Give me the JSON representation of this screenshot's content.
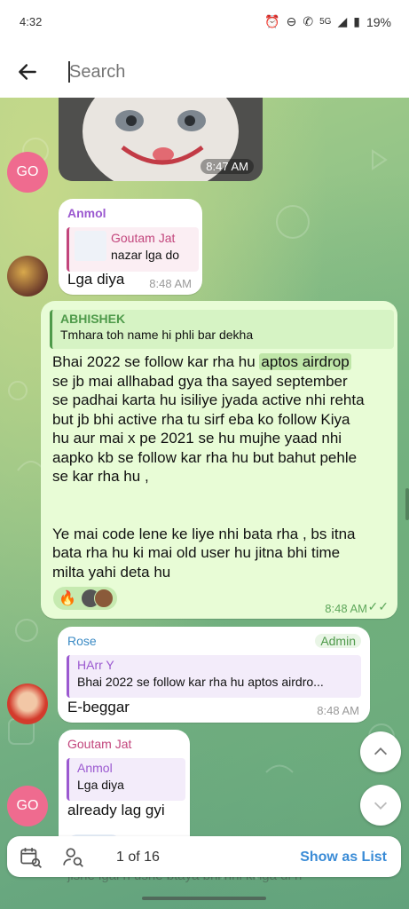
{
  "status_bar": {
    "time": "4:32",
    "network": "5G",
    "battery": "19%"
  },
  "search": {
    "placeholder": "Search"
  },
  "messages": [
    {
      "type": "photo",
      "time": "8:47 AM",
      "avatar_initials": "GO"
    },
    {
      "sender": "Anmol",
      "reply_to": {
        "name": "Goutam Jat",
        "text": "nazar lga do"
      },
      "text": "Lga diya",
      "time": "8:48 AM"
    },
    {
      "reply_to": {
        "name": "ABHISHEK",
        "text": "Tmhara toh name hi phli bar dekha"
      },
      "lines": [
        "Bhai 2022 se follow kar rha hu aptos airdrop",
        "se jb mai allhabad gya tha sayed september",
        "se padhai karta hu isiliye jyada active nhi rehta",
        "but jb bhi active rha tu sirf eba ko follow Kiya",
        "hu aur mai x pe 2021 se hu mujhe yaad nhi",
        "aapko kb se follow kar rha hu but bahut pehle",
        "se kar rha hu ,",
        "",
        "",
        "Ye mai code lene ke liye nhi bata rha , bs itna",
        "bata rha hu ki mai old user hu jitna bhi time",
        "milta yahi deta hu"
      ],
      "highlight": "aptos airdrop",
      "reaction_emoji": "🔥",
      "time": "8:48 AM"
    },
    {
      "sender": "Rose",
      "badge": "Admin",
      "reply_to": {
        "name": "HArr Y",
        "text": "Bhai 2022 se follow kar rha hu aptos airdro..."
      },
      "text": "E-beggar",
      "time": "8:48 AM"
    },
    {
      "sender": "Goutam Jat",
      "reply_to": {
        "name": "Anmol",
        "text": "Lga diya"
      },
      "text": "already lag gyi",
      "avatar_initials": "GO"
    }
  ],
  "bottom_peek_text": "jisne lgai h ushe btaya bhi nhi ki lga di h",
  "search_bar": {
    "counter": "1 of 16",
    "show_as_list": "Show as List"
  },
  "colors": {
    "accent": "#3a8bd6",
    "sender_purple": "#9b59d0",
    "sender_pink": "#c2457c",
    "sender_green": "#4e9a4a",
    "sender_blue": "#3a8ac4",
    "outgoing": "#e8fcd6"
  }
}
